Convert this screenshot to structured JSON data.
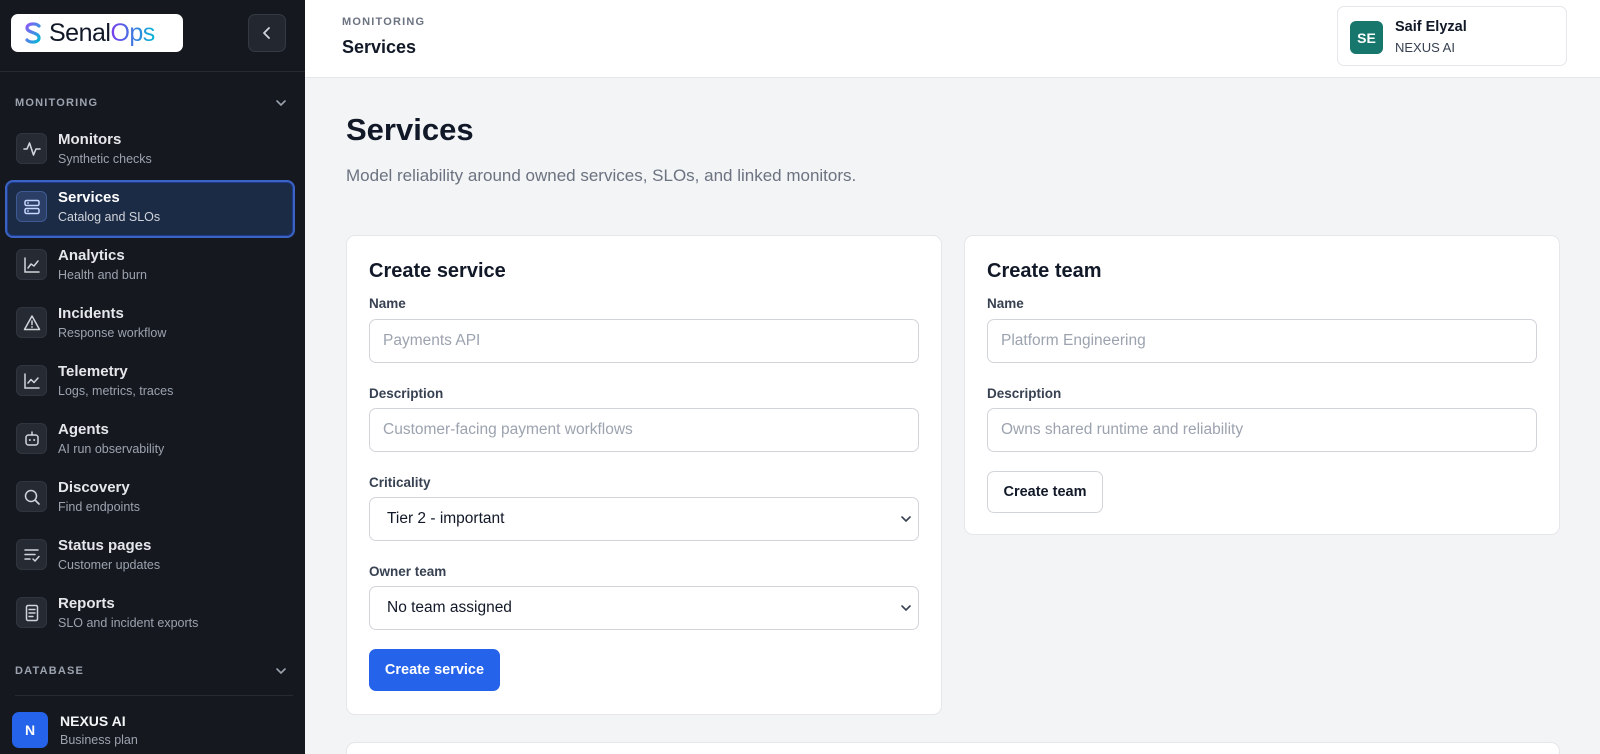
{
  "brand": {
    "name_part1": "Senal",
    "name_part2": "Ops"
  },
  "sidebar": {
    "monitoring_header": "MONITORING",
    "database_header": "DATABASE",
    "items": [
      {
        "title": "Monitors",
        "subtitle": "Synthetic checks",
        "icon": "activity-icon"
      },
      {
        "title": "Services",
        "subtitle": "Catalog and SLOs",
        "icon": "server-icon",
        "active": true
      },
      {
        "title": "Analytics",
        "subtitle": "Health and burn",
        "icon": "chart-icon"
      },
      {
        "title": "Incidents",
        "subtitle": "Response workflow",
        "icon": "alert-triangle-icon"
      },
      {
        "title": "Telemetry",
        "subtitle": "Logs, metrics, traces",
        "icon": "line-chart-icon"
      },
      {
        "title": "Agents",
        "subtitle": "AI run observability",
        "icon": "bot-icon"
      },
      {
        "title": "Discovery",
        "subtitle": "Find endpoints",
        "icon": "search-icon"
      },
      {
        "title": "Status pages",
        "subtitle": "Customer updates",
        "icon": "list-check-icon"
      },
      {
        "title": "Reports",
        "subtitle": "SLO and incident exports",
        "icon": "file-text-icon"
      }
    ],
    "org": {
      "initial": "N",
      "name": "NEXUS AI",
      "plan": "Business plan"
    }
  },
  "header": {
    "eyebrow": "MONITORING",
    "title": "Services",
    "user": {
      "initials": "SE",
      "name": "Saif Elyzal",
      "org": "NEXUS AI"
    }
  },
  "main": {
    "title": "Services",
    "subtitle": "Model reliability around owned services, SLOs, and linked monitors.",
    "create_service": {
      "title": "Create service",
      "name_label": "Name",
      "name_placeholder": "Payments API",
      "description_label": "Description",
      "description_placeholder": "Customer-facing payment workflows",
      "criticality_label": "Criticality",
      "criticality_value": "Tier 2 - important",
      "owner_label": "Owner team",
      "owner_value": "No team assigned",
      "submit_label": "Create service"
    },
    "create_team": {
      "title": "Create team",
      "name_label": "Name",
      "name_placeholder": "Platform Engineering",
      "description_label": "Description",
      "description_placeholder": "Owns shared runtime and reliability",
      "submit_label": "Create team"
    }
  },
  "colors": {
    "accent": "#2563eb",
    "sidebar_bg": "#15191f",
    "user_avatar": "#17776d"
  }
}
